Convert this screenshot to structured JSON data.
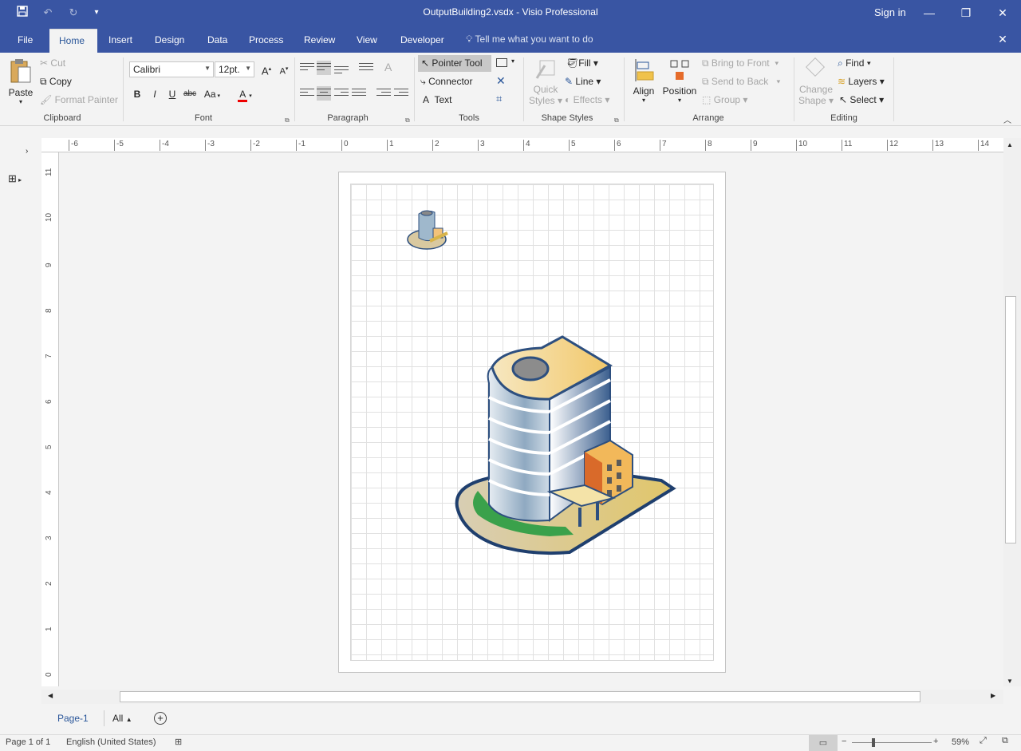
{
  "window": {
    "title": "OutputBuilding2.vsdx - Visio Professional",
    "sign_in": "Sign in",
    "qat": {
      "save_icon": "save-icon",
      "undo_icon": "undo-icon",
      "redo_icon": "redo-icon",
      "customize_icon": "customize-icon"
    }
  },
  "tabs": [
    "File",
    "Home",
    "Insert",
    "Design",
    "Data",
    "Process",
    "Review",
    "View",
    "Developer"
  ],
  "active_tab": "Home",
  "tell_me": "Tell me what you want to do",
  "clipboard": {
    "paste": "Paste",
    "cut": "Cut",
    "copy": "Copy",
    "format_painter": "Format Painter",
    "label": "Clipboard"
  },
  "font": {
    "family": "Calibri",
    "size": "12pt.",
    "label": "Font",
    "bold": "B",
    "italic": "I",
    "underline": "U",
    "strike": "abc",
    "case": "Aa",
    "color": "A",
    "grow": "A",
    "shrink": "A"
  },
  "paragraph": {
    "label": "Paragraph"
  },
  "tools": {
    "pointer": "Pointer Tool",
    "connector": "Connector",
    "text": "Text",
    "label": "Tools"
  },
  "shape_styles": {
    "quick_styles_1": "Quick",
    "quick_styles_2": "Styles",
    "fill": "Fill",
    "line": "Line",
    "effects": "Effects",
    "label": "Shape Styles"
  },
  "arrange": {
    "align": "Align",
    "position": "Position",
    "bring_front": "Bring to Front",
    "send_back": "Send to Back",
    "group": "Group",
    "label": "Arrange"
  },
  "editing": {
    "change_shape_1": "Change",
    "change_shape_2": "Shape",
    "find": "Find",
    "layers": "Layers",
    "select": "Select",
    "label": "Editing"
  },
  "rulers": {
    "horizontal": [
      "-6",
      "-5",
      "-4",
      "-3",
      "-2",
      "-1",
      "0",
      "1",
      "2",
      "3",
      "4",
      "5",
      "6",
      "7",
      "8",
      "9",
      "10",
      "11",
      "12",
      "13",
      "14"
    ],
    "vertical": [
      "11",
      "10",
      "9",
      "8",
      "7",
      "6",
      "5",
      "4",
      "3",
      "2",
      "1",
      "0"
    ]
  },
  "page_tabs": {
    "current": "Page-1",
    "all": "All"
  },
  "status": {
    "page": "Page 1 of 1",
    "language": "English (United States)",
    "zoom": "59%"
  },
  "colors": {
    "accent": "#3955a3",
    "tab_text": "#2b579a"
  }
}
